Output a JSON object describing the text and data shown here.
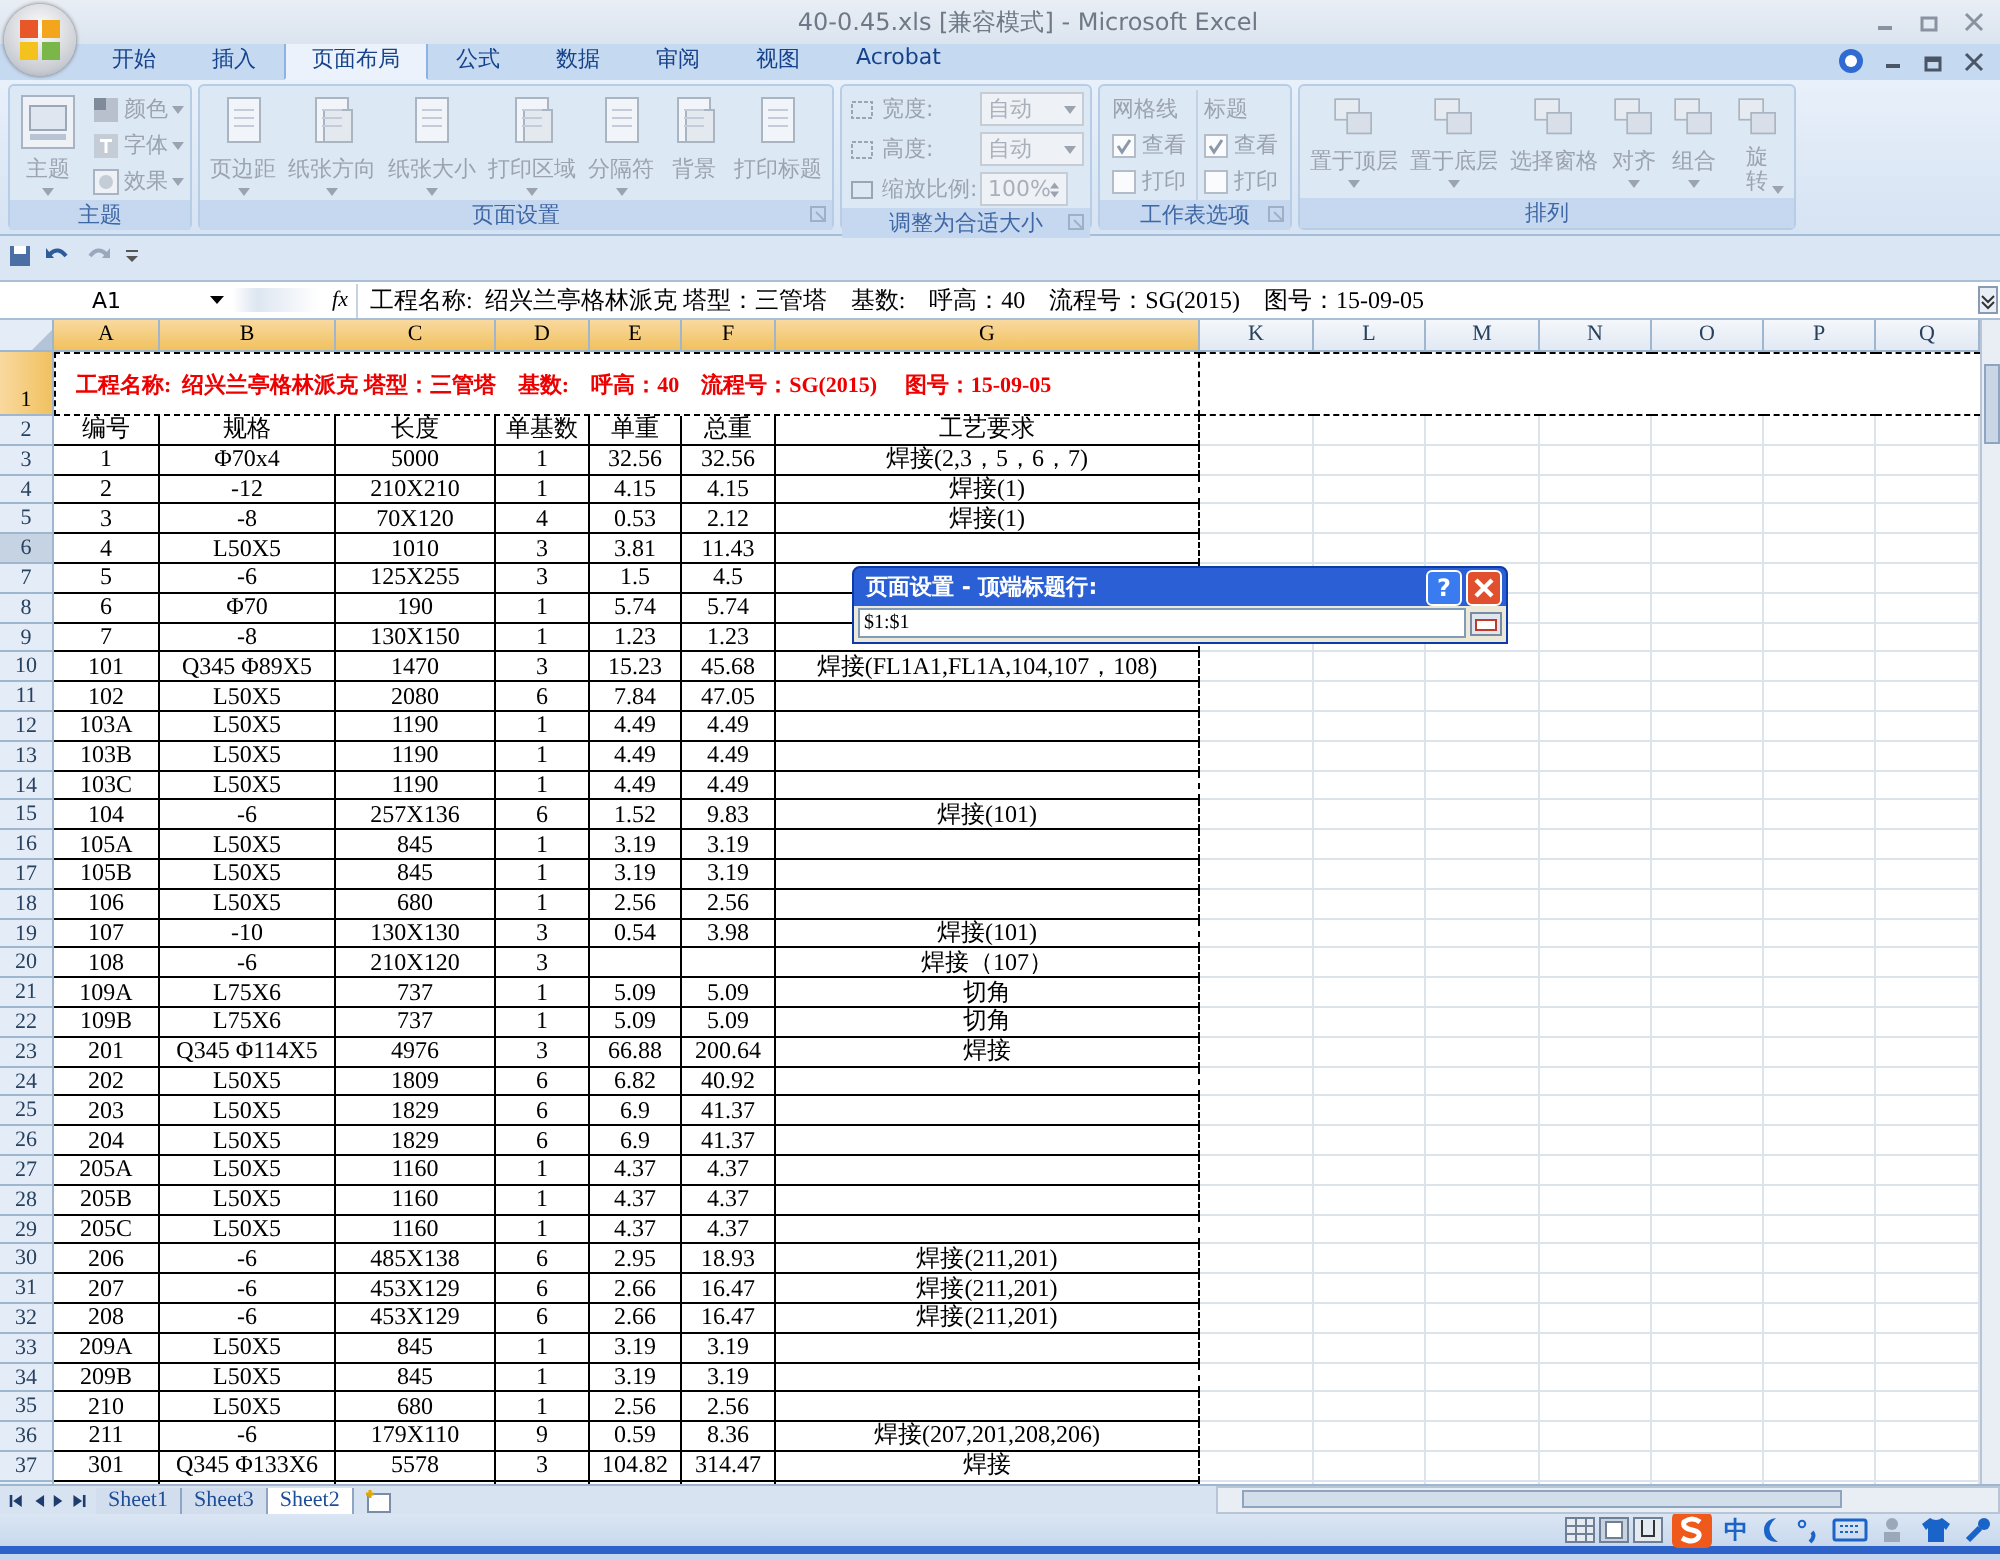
{
  "title_bar": {
    "title": "40-0.45.xls  [兼容模式] - Microsoft Excel"
  },
  "ribbon_tabs": [
    {
      "label": "开始",
      "selected": false
    },
    {
      "label": "插入",
      "selected": false
    },
    {
      "label": "页面布局",
      "selected": true
    },
    {
      "label": "公式",
      "selected": false
    },
    {
      "label": "数据",
      "selected": false
    },
    {
      "label": "审阅",
      "selected": false
    },
    {
      "label": "视图",
      "selected": false
    },
    {
      "label": "Acrobat",
      "selected": false
    }
  ],
  "ribbon": {
    "disabled": true,
    "groups": [
      {
        "kind": "themes",
        "label": "主题",
        "launcher": false,
        "large": [
          {
            "label": "主题",
            "dropdown": true
          }
        ],
        "small": [
          {
            "label": "颜色"
          },
          {
            "label": "字体"
          },
          {
            "label": "效果"
          }
        ]
      },
      {
        "kind": "pagesetup",
        "label": "页面设置",
        "launcher": true,
        "large": [
          {
            "label": "页边距",
            "dropdown": true
          },
          {
            "label": "纸张方向",
            "dropdown": true
          },
          {
            "label": "纸张大小",
            "dropdown": true
          },
          {
            "label": "打印区域",
            "dropdown": true
          },
          {
            "label": "分隔符",
            "dropdown": true
          },
          {
            "label": "背景",
            "dropdown": false
          },
          {
            "label": "打印标题",
            "dropdown": false
          }
        ]
      },
      {
        "kind": "scale",
        "label": "调整为合适大小",
        "launcher": true,
        "fields": [
          {
            "label": "宽度:",
            "value": "自动",
            "kind": "dropdown"
          },
          {
            "label": "高度:",
            "value": "自动",
            "kind": "dropdown"
          },
          {
            "label": "缩放比例:",
            "value": "100%",
            "kind": "spinner"
          }
        ]
      },
      {
        "kind": "options",
        "label": "工作表选项",
        "launcher": true,
        "columns": [
          {
            "heading": "网格线",
            "boxes": [
              {
                "label": "查看",
                "checked": true
              },
              {
                "label": "打印",
                "checked": false
              }
            ]
          },
          {
            "heading": "标题",
            "boxes": [
              {
                "label": "查看",
                "checked": true
              },
              {
                "label": "打印",
                "checked": false
              }
            ]
          }
        ]
      },
      {
        "kind": "arrange",
        "label": "排列",
        "launcher": false,
        "large": [
          {
            "label": "置于顶层",
            "dropdown": true
          },
          {
            "label": "置于底层",
            "dropdown": true
          },
          {
            "label": "选择窗格",
            "dropdown": false
          },
          {
            "label": "对齐",
            "dropdown": true
          },
          {
            "label": "组合",
            "dropdown": true
          },
          {
            "label": "旋转",
            "dropdown": true
          }
        ]
      }
    ]
  },
  "formula_bar": {
    "name_box": "A1",
    "function_label": "fx",
    "formula": "工程名称:  绍兴兰亭格林派克 塔型：三管塔    基数:    呼高：40    流程号：SG(2015)    图号：15-09-05"
  },
  "sheet": {
    "columns": [
      {
        "label": "A",
        "selected": true
      },
      {
        "label": "B",
        "selected": true
      },
      {
        "label": "C",
        "selected": true
      },
      {
        "label": "D",
        "selected": true
      },
      {
        "label": "E",
        "selected": true
      },
      {
        "label": "F",
        "selected": true
      },
      {
        "label": "G",
        "selected": true
      },
      {
        "label": "K",
        "selected": false
      },
      {
        "label": "L",
        "selected": false
      },
      {
        "label": "M",
        "selected": false
      },
      {
        "label": "N",
        "selected": false
      },
      {
        "label": "O",
        "selected": false
      },
      {
        "label": "P",
        "selected": false
      },
      {
        "label": "Q",
        "selected": false
      }
    ],
    "title_row": {
      "number": "1",
      "selected": true,
      "text": "工程名称:  绍兴兰亭格林派克 塔型：三管塔    基数:    呼高：40    流程号：SG(2015)     图号：15-09-05"
    },
    "header_row": {
      "number": "2",
      "hovered": false,
      "cells": [
        "编号",
        "规格",
        "长度",
        "单基数",
        "单重",
        "总重",
        "工艺要求"
      ]
    },
    "rows": [
      {
        "number": "3",
        "hovered": false,
        "cells": [
          "1",
          "Φ70x4",
          "5000",
          "1",
          "32.56",
          "32.56",
          "焊接(2,3，5，6，7)"
        ]
      },
      {
        "number": "4",
        "hovered": false,
        "cells": [
          "2",
          "-12",
          "210X210",
          "1",
          "4.15",
          "4.15",
          "焊接(1)"
        ]
      },
      {
        "number": "5",
        "hovered": false,
        "cells": [
          "3",
          "-8",
          "70X120",
          "4",
          "0.53",
          "2.12",
          "焊接(1)"
        ]
      },
      {
        "number": "6",
        "hovered": true,
        "cells": [
          "4",
          "L50X5",
          "1010",
          "3",
          "3.81",
          "11.43",
          null
        ]
      },
      {
        "number": "7",
        "hovered": false,
        "cells": [
          "5",
          "-6",
          "125X255",
          "3",
          "1.5",
          "4.5",
          null
        ]
      },
      {
        "number": "8",
        "hovered": false,
        "cells": [
          "6",
          "Φ70",
          "190",
          "1",
          "5.74",
          "5.74",
          null
        ]
      },
      {
        "number": "9",
        "hovered": false,
        "cells": [
          "7",
          "-8",
          "130X150",
          "1",
          "1.23",
          "1.23",
          null
        ]
      },
      {
        "number": "10",
        "hovered": false,
        "cells": [
          "101",
          "Q345  Φ89X5",
          "1470",
          "3",
          "15.23",
          "45.68",
          "焊接(FL1A1,FL1A,104,107，108)"
        ]
      },
      {
        "number": "11",
        "hovered": false,
        "cells": [
          "102",
          "L50X5",
          "2080",
          "6",
          "7.84",
          "47.05",
          null
        ]
      },
      {
        "number": "12",
        "hovered": false,
        "cells": [
          "103A",
          "L50X5",
          "1190",
          "1",
          "4.49",
          "4.49",
          null
        ]
      },
      {
        "number": "13",
        "hovered": false,
        "cells": [
          "103B",
          "L50X5",
          "1190",
          "1",
          "4.49",
          "4.49",
          null
        ]
      },
      {
        "number": "14",
        "hovered": false,
        "cells": [
          "103C",
          "L50X5",
          "1190",
          "1",
          "4.49",
          "4.49",
          null
        ]
      },
      {
        "number": "15",
        "hovered": false,
        "cells": [
          "104",
          "-6",
          "257X136",
          "6",
          "1.52",
          "9.83",
          "焊接(101)"
        ]
      },
      {
        "number": "16",
        "hovered": false,
        "cells": [
          "105A",
          "L50X5",
          "845",
          "1",
          "3.19",
          "3.19",
          null
        ]
      },
      {
        "number": "17",
        "hovered": false,
        "cells": [
          "105B",
          "L50X5",
          "845",
          "1",
          "3.19",
          "3.19",
          null
        ]
      },
      {
        "number": "18",
        "hovered": false,
        "cells": [
          "106",
          "L50X5",
          "680",
          "1",
          "2.56",
          "2.56",
          null
        ]
      },
      {
        "number": "19",
        "hovered": false,
        "cells": [
          "107",
          "-10",
          "130X130",
          "3",
          "0.54",
          "3.98",
          "焊接(101)"
        ]
      },
      {
        "number": "20",
        "hovered": false,
        "cells": [
          "108",
          "-6",
          "210X120",
          "3",
          null,
          null,
          "焊接（107）"
        ]
      },
      {
        "number": "21",
        "hovered": false,
        "cells": [
          "109A",
          "L75X6",
          "737",
          "1",
          "5.09",
          "5.09",
          "切角"
        ]
      },
      {
        "number": "22",
        "hovered": false,
        "cells": [
          "109B",
          "L75X6",
          "737",
          "1",
          "5.09",
          "5.09",
          "切角"
        ]
      },
      {
        "number": "23",
        "hovered": false,
        "cells": [
          "201",
          "Q345  Φ114X5",
          "4976",
          "3",
          "66.88",
          "200.64",
          "焊接"
        ]
      },
      {
        "number": "24",
        "hovered": false,
        "cells": [
          "202",
          "L50X5",
          "1809",
          "6",
          "6.82",
          "40.92",
          null
        ]
      },
      {
        "number": "25",
        "hovered": false,
        "cells": [
          "203",
          "L50X5",
          "1829",
          "6",
          "6.9",
          "41.37",
          null
        ]
      },
      {
        "number": "26",
        "hovered": false,
        "cells": [
          "204",
          "L50X5",
          "1829",
          "6",
          "6.9",
          "41.37",
          null
        ]
      },
      {
        "number": "27",
        "hovered": false,
        "cells": [
          "205A",
          "L50X5",
          "1160",
          "1",
          "4.37",
          "4.37",
          null
        ]
      },
      {
        "number": "28",
        "hovered": false,
        "cells": [
          "205B",
          "L50X5",
          "1160",
          "1",
          "4.37",
          "4.37",
          null
        ]
      },
      {
        "number": "29",
        "hovered": false,
        "cells": [
          "205C",
          "L50X5",
          "1160",
          "1",
          "4.37",
          "4.37",
          null
        ]
      },
      {
        "number": "30",
        "hovered": false,
        "cells": [
          "206",
          "-6",
          "485X138",
          "6",
          "2.95",
          "18.93",
          "焊接(211,201)"
        ]
      },
      {
        "number": "31",
        "hovered": false,
        "cells": [
          "207",
          "-6",
          "453X129",
          "6",
          "2.66",
          "16.47",
          "焊接(211,201)"
        ]
      },
      {
        "number": "32",
        "hovered": false,
        "cells": [
          "208",
          "-6",
          "453X129",
          "6",
          "2.66",
          "16.47",
          "焊接(211,201)"
        ]
      },
      {
        "number": "33",
        "hovered": false,
        "cells": [
          "209A",
          "L50X5",
          "845",
          "1",
          "3.19",
          "3.19",
          null
        ]
      },
      {
        "number": "34",
        "hovered": false,
        "cells": [
          "209B",
          "L50X5",
          "845",
          "1",
          "3.19",
          "3.19",
          null
        ]
      },
      {
        "number": "35",
        "hovered": false,
        "cells": [
          "210",
          "L50X5",
          "680",
          "1",
          "2.56",
          "2.56",
          null
        ]
      },
      {
        "number": "36",
        "hovered": false,
        "cells": [
          "211",
          "-6",
          "179X110",
          "9",
          "0.59",
          "8.36",
          "焊接(207,201,208,206)"
        ]
      },
      {
        "number": "37",
        "hovered": false,
        "cells": [
          "301",
          "Q345  Φ133X6",
          "5578",
          "3",
          "104.82",
          "314.47",
          "焊接"
        ]
      }
    ]
  },
  "dialog": {
    "title": "页面设置 - 顶端标题行:",
    "help_label": "?",
    "value": "$1:$1"
  },
  "sheet_tabs": [
    {
      "label": "Sheet1",
      "selected": false
    },
    {
      "label": "Sheet3",
      "selected": false
    },
    {
      "label": "Sheet2",
      "selected": true
    }
  ],
  "status_bar": {
    "ime_mode": "中"
  }
}
